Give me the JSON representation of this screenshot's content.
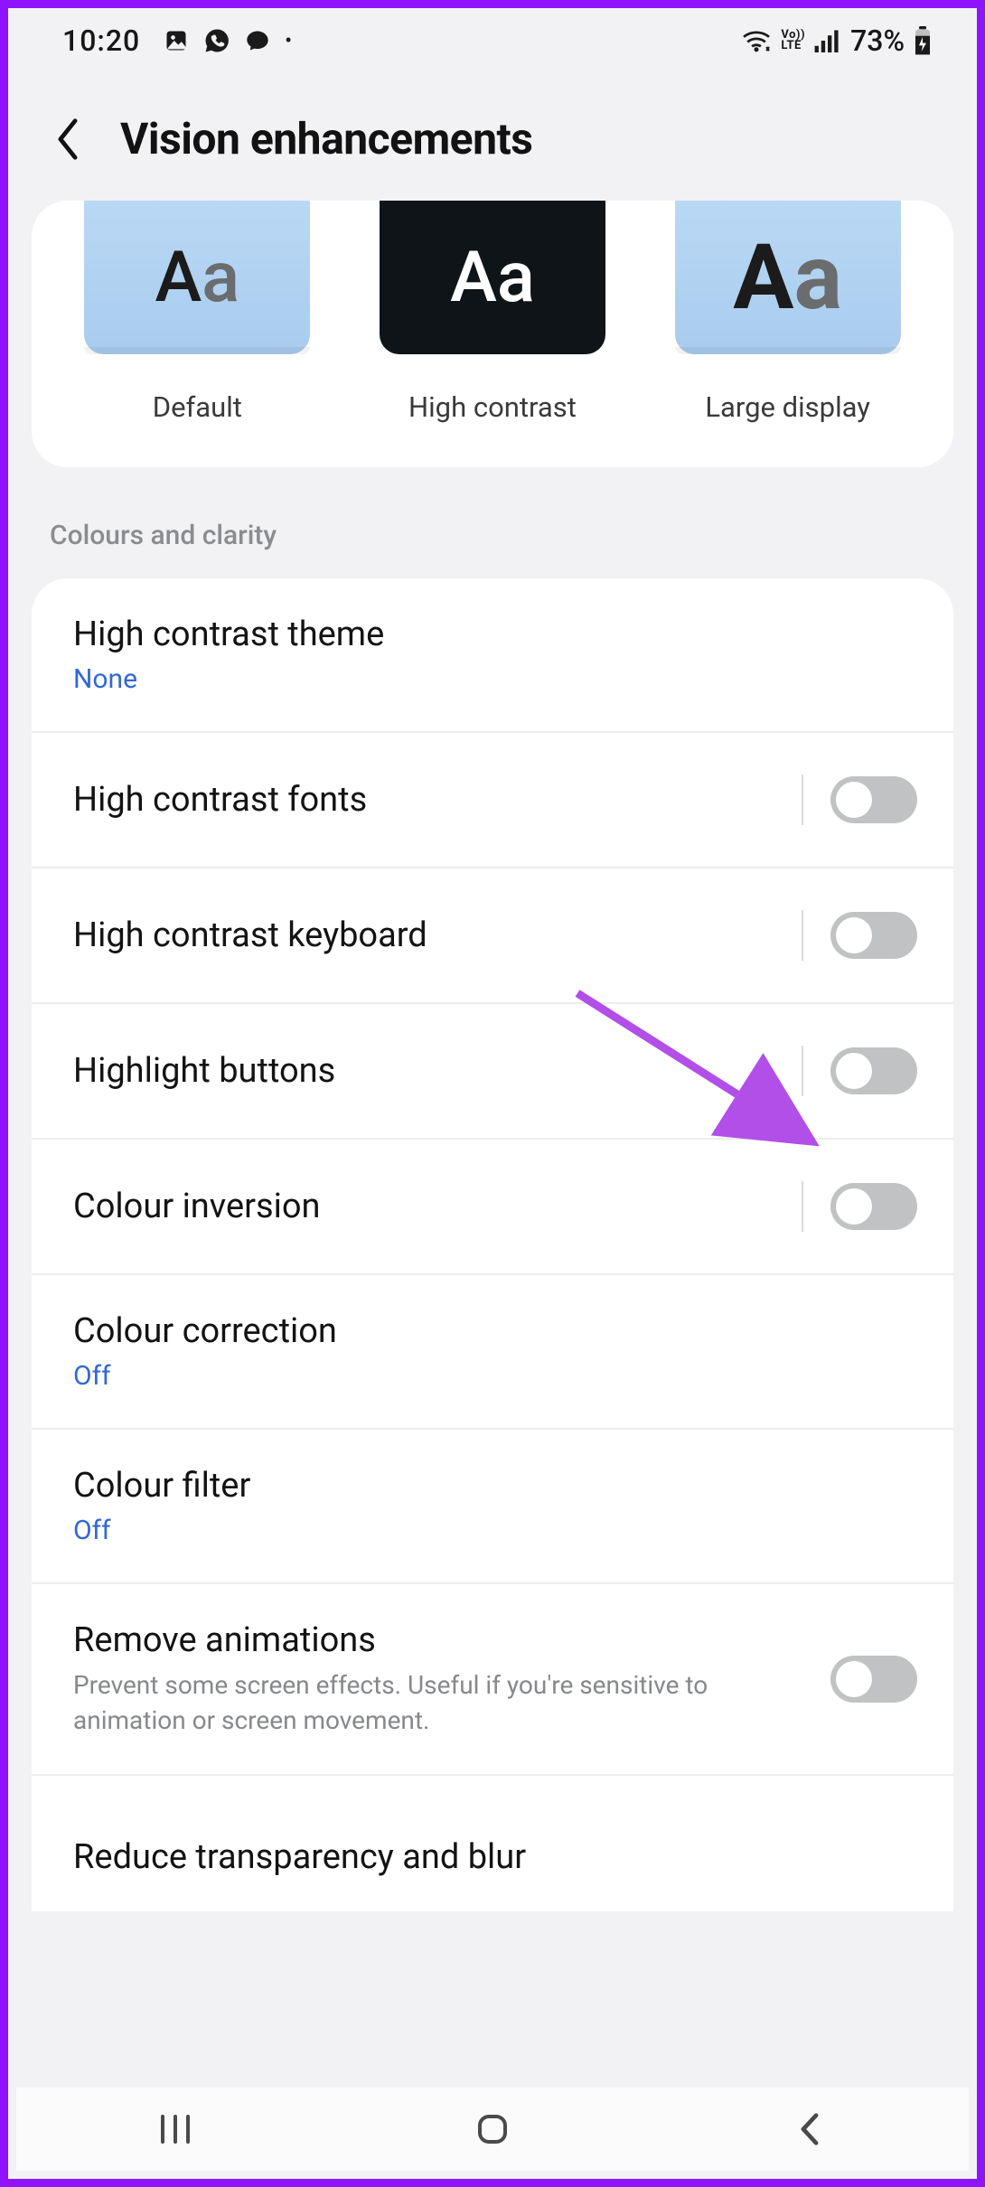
{
  "status": {
    "time": "10:20",
    "battery_pct": "73%"
  },
  "header": {
    "title": "Vision enhancements"
  },
  "previews": [
    {
      "label": "Default"
    },
    {
      "label": "High contrast"
    },
    {
      "label": "Large display"
    }
  ],
  "section_header": "Colours and clarity",
  "rows": {
    "hc_theme": {
      "title": "High contrast theme",
      "sub": "None"
    },
    "hc_fonts": {
      "title": "High contrast fonts"
    },
    "hc_kbd": {
      "title": "High contrast keyboard"
    },
    "highlight": {
      "title": "Highlight buttons"
    },
    "inversion": {
      "title": "Colour inversion"
    },
    "correction": {
      "title": "Colour correction",
      "sub": "Off"
    },
    "filter": {
      "title": "Colour filter",
      "sub": "Off"
    },
    "anim": {
      "title": "Remove animations",
      "desc": "Prevent some screen effects. Useful if you're sensitive to animation or screen movement."
    },
    "trans": {
      "title": "Reduce transparency and blur"
    }
  }
}
